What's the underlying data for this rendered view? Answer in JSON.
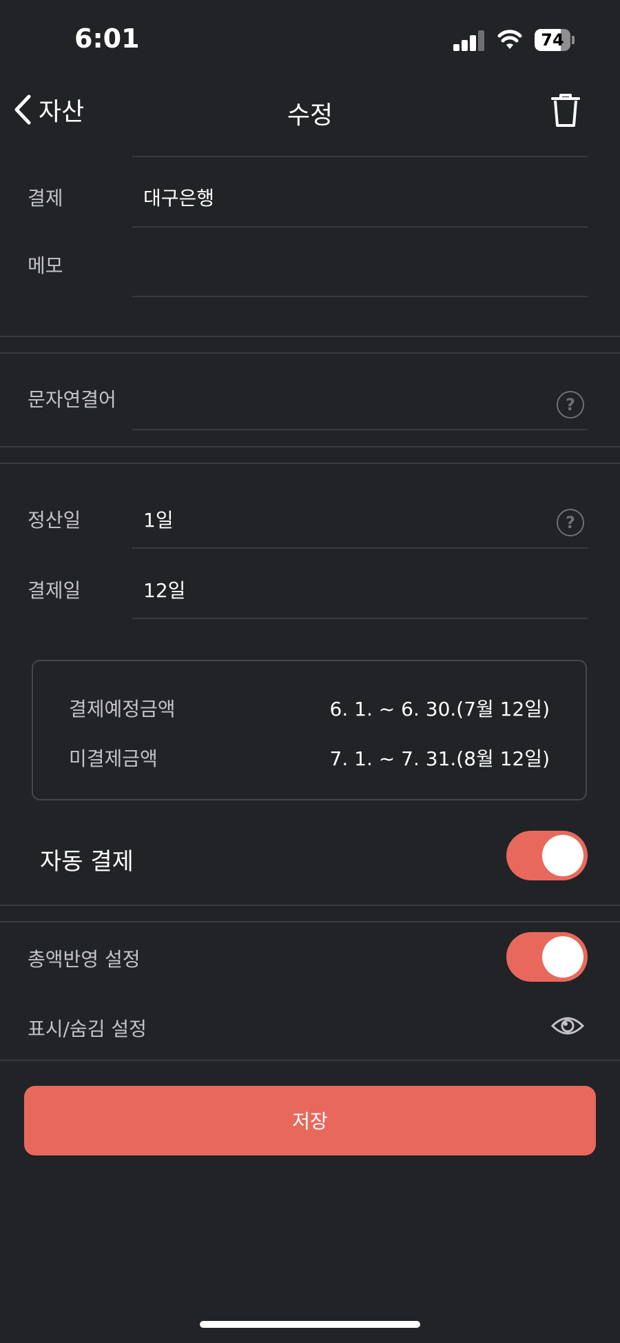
{
  "status_bar": {
    "time": "6:01",
    "battery_level": "74",
    "battery_fraction": 0.74
  },
  "nav": {
    "back_label": "자산",
    "title": "수정"
  },
  "form": {
    "payment_label": "결제",
    "payment_value": "대구은행",
    "memo_label": "메모",
    "memo_value": "",
    "sms_label": "문자연결어",
    "settlement_label": "정산일",
    "settlement_value": "1일",
    "paydate_label": "결제일",
    "paydate_value": "12일",
    "help_glyph": "?"
  },
  "periods": [
    {
      "label": "결제예정금액",
      "value": "6. 1. ~ 6. 30.(7월 12일)"
    },
    {
      "label": "미결제금액",
      "value": "7. 1. ~ 7. 31.(8월 12일)"
    }
  ],
  "auto_payment": {
    "label": "자동 결제",
    "enabled": true
  },
  "total_reflect": {
    "label": "총액반영 설정",
    "enabled": true
  },
  "visibility": {
    "label": "표시/숨김 설정",
    "icon": "eye-icon"
  },
  "save_label": "저장",
  "colors": {
    "background": "#222327",
    "accent": "#e8695c",
    "divider": "#3a3b40"
  }
}
